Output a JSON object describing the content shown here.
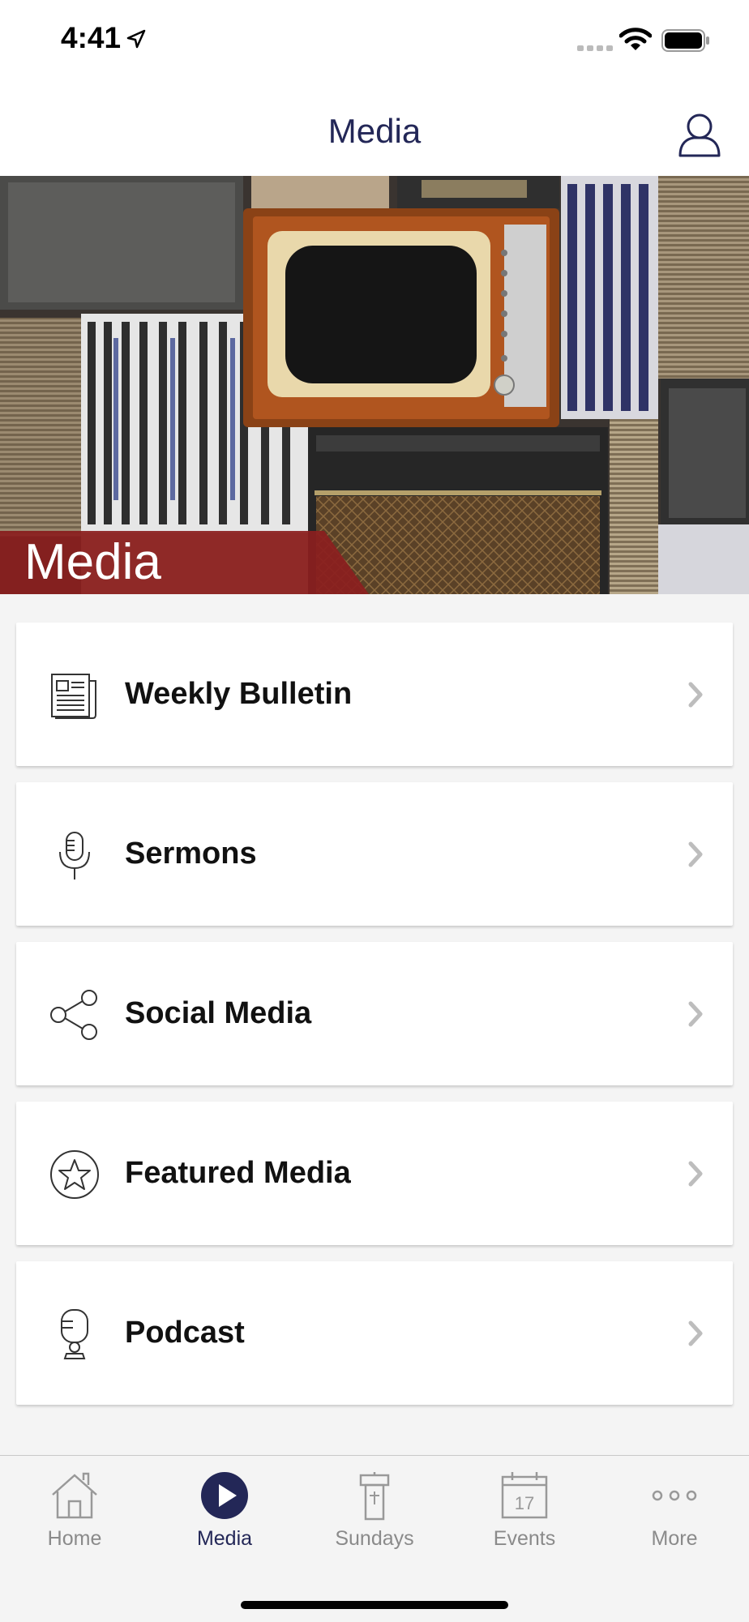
{
  "status_bar": {
    "time": "4:41"
  },
  "header": {
    "title": "Media"
  },
  "hero": {
    "caption": "Media"
  },
  "menu": [
    {
      "label": "Weekly Bulletin",
      "icon": "newspaper-icon"
    },
    {
      "label": "Sermons",
      "icon": "microphone-icon"
    },
    {
      "label": "Social Media",
      "icon": "share-icon"
    },
    {
      "label": "Featured Media",
      "icon": "star-icon"
    },
    {
      "label": "Podcast",
      "icon": "podcast-icon"
    }
  ],
  "tabs": [
    {
      "label": "Home",
      "icon": "home-icon",
      "active": false
    },
    {
      "label": "Media",
      "icon": "play-icon",
      "active": true
    },
    {
      "label": "Sundays",
      "icon": "pulpit-icon",
      "active": false
    },
    {
      "label": "Events",
      "icon": "calendar-icon",
      "active": false,
      "calendar_day": "17"
    },
    {
      "label": "More",
      "icon": "more-icon",
      "active": false
    }
  ],
  "colors": {
    "accent": "#232757",
    "hero_band": "#8b1e1e",
    "inactive": "#8a8a8a"
  }
}
